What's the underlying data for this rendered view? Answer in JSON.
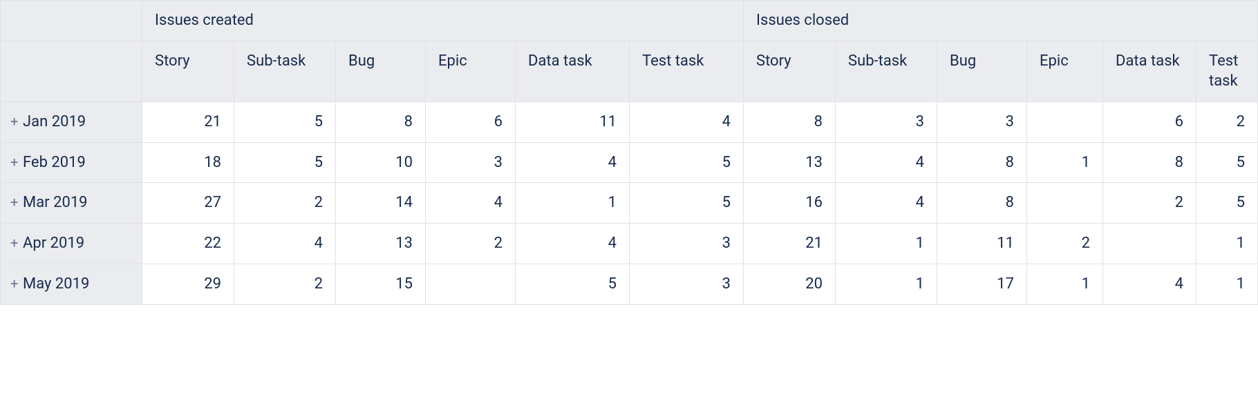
{
  "groups": [
    {
      "label": "Issues created"
    },
    {
      "label": "Issues closed"
    }
  ],
  "cols": [
    {
      "label": "Story"
    },
    {
      "label": "Sub-task"
    },
    {
      "label": "Bug"
    },
    {
      "label": "Epic"
    },
    {
      "label": "Data task"
    },
    {
      "label": "Test task"
    }
  ],
  "expand_glyph": "+",
  "rows": [
    {
      "label": "Jan 2019",
      "created": {
        "story": "21",
        "subtask": "5",
        "bug": "8",
        "epic": "6",
        "data": "11",
        "test": "4"
      },
      "closed": {
        "story": "8",
        "subtask": "3",
        "bug": "3",
        "epic": "",
        "data": "6",
        "test": "2"
      }
    },
    {
      "label": "Feb 2019",
      "created": {
        "story": "18",
        "subtask": "5",
        "bug": "10",
        "epic": "3",
        "data": "4",
        "test": "5"
      },
      "closed": {
        "story": "13",
        "subtask": "4",
        "bug": "8",
        "epic": "1",
        "data": "8",
        "test": "5"
      }
    },
    {
      "label": "Mar 2019",
      "created": {
        "story": "27",
        "subtask": "2",
        "bug": "14",
        "epic": "4",
        "data": "1",
        "test": "5"
      },
      "closed": {
        "story": "16",
        "subtask": "4",
        "bug": "8",
        "epic": "",
        "data": "2",
        "test": "5"
      }
    },
    {
      "label": "Apr 2019",
      "created": {
        "story": "22",
        "subtask": "4",
        "bug": "13",
        "epic": "2",
        "data": "4",
        "test": "3"
      },
      "closed": {
        "story": "21",
        "subtask": "1",
        "bug": "11",
        "epic": "2",
        "data": "",
        "test": "1"
      }
    },
    {
      "label": "May 2019",
      "created": {
        "story": "29",
        "subtask": "2",
        "bug": "15",
        "epic": "",
        "data": "5",
        "test": "3"
      },
      "closed": {
        "story": "20",
        "subtask": "1",
        "bug": "17",
        "epic": "1",
        "data": "4",
        "test": "1"
      }
    }
  ]
}
